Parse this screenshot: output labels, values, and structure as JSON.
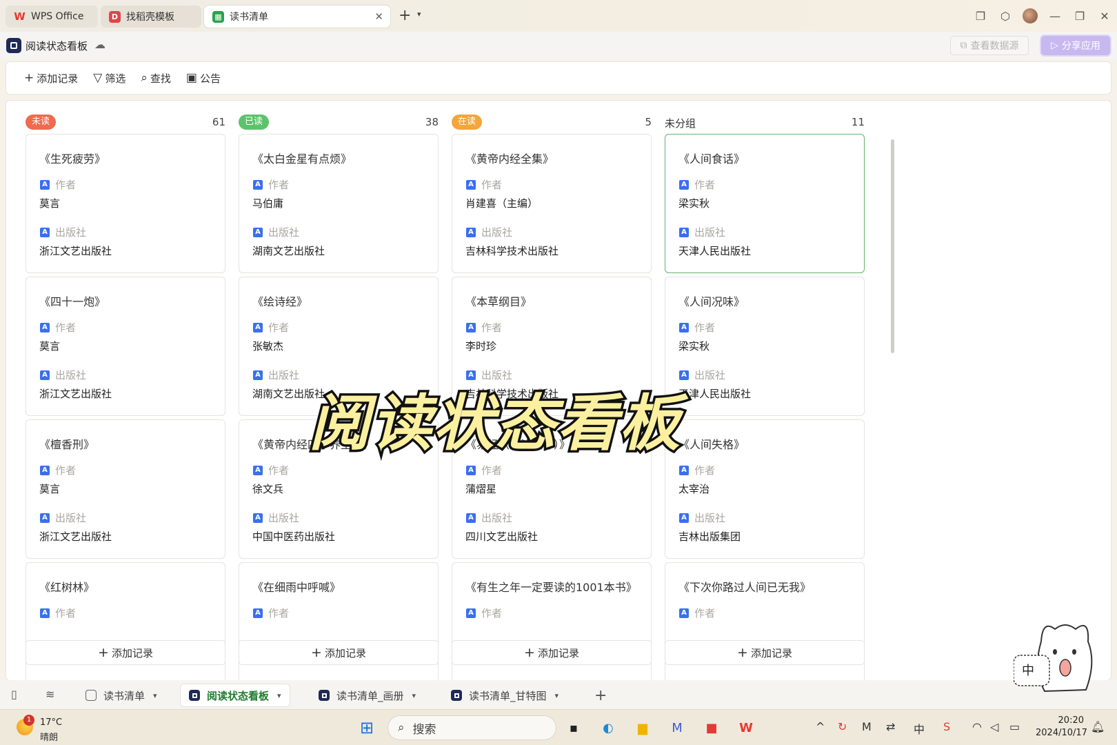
{
  "titlebar": {
    "tabs": [
      {
        "label": "WPS Office",
        "icon": "wps-logo-icon"
      },
      {
        "label": "找稻壳模板",
        "icon": "daoke-icon"
      },
      {
        "label": "读书清单",
        "icon": "sheet-icon"
      }
    ],
    "new_tab": "+"
  },
  "app": {
    "title": "阅读状态看板",
    "view_data_source": "查看数据源",
    "share_app": "分享应用"
  },
  "toolbar": {
    "add_record": "添加记录",
    "filter": "筛选",
    "find": "查找",
    "notice": "公告"
  },
  "labels": {
    "author": "作者",
    "publisher": "出版社",
    "add_record": "添加记录"
  },
  "columns": [
    {
      "name": "未读",
      "count": "61",
      "badge_color": "#ef6a4e",
      "badge": true,
      "cards": [
        {
          "title": "《生死疲劳》",
          "author": "莫言",
          "publisher": "浙江文艺出版社"
        },
        {
          "title": "《四十一炮》",
          "author": "莫言",
          "publisher": "浙江文艺出版社"
        },
        {
          "title": "《檀香刑》",
          "author": "莫言",
          "publisher": "浙江文艺出版社"
        },
        {
          "title": "《红树林》",
          "author": "",
          "publisher": ""
        }
      ]
    },
    {
      "name": "已读",
      "count": "38",
      "badge_color": "#5cc36a",
      "badge": true,
      "cards": [
        {
          "title": "《太白金星有点烦》",
          "author": "马伯庸",
          "publisher": "湖南文艺出版社"
        },
        {
          "title": "《绘诗经》",
          "author": "张敏杰",
          "publisher": "湖南文艺出版社"
        },
        {
          "title": "《黄帝内经四季养生法》",
          "author": "徐文兵",
          "publisher": "中国中医药出版社"
        },
        {
          "title": "《在细雨中呼喊》",
          "author": "",
          "publisher": ""
        }
      ]
    },
    {
      "name": "在读",
      "count": "5",
      "badge_color": "#f4a53c",
      "badge": true,
      "cards": [
        {
          "title": "《黄帝内经全集》",
          "author": "肖建喜（主编）",
          "publisher": "吉林科学技术出版社"
        },
        {
          "title": "《本草纲目》",
          "author": "李时珍",
          "publisher": "吉林科学技术出版社"
        },
        {
          "title": "《易经（全注全译）》",
          "author": "蒲熠星",
          "publisher": "四川文艺出版社"
        },
        {
          "title": "《有生之年一定要读的1001本书》",
          "author": "",
          "publisher": ""
        }
      ]
    },
    {
      "name": "未分组",
      "count": "11",
      "badge_color": "",
      "badge": false,
      "cards": [
        {
          "title": "《人间食话》",
          "author": "梁实秋",
          "publisher": "天津人民出版社"
        },
        {
          "title": "《人间况味》",
          "author": "梁实秋",
          "publisher": "天津人民出版社"
        },
        {
          "title": "《人间失格》",
          "author": "太宰治",
          "publisher": "吉林出版集团"
        },
        {
          "title": "《下次你路过人间已无我》",
          "author": "",
          "publisher": ""
        }
      ]
    }
  ],
  "overlay_caption": "阅读状态看板",
  "sheets": [
    {
      "label": "读书清单",
      "icon": "grid-table-icon",
      "active": false
    },
    {
      "label": "阅读状态看板",
      "icon": "kanban-icon",
      "active": true
    },
    {
      "label": "读书清单_画册",
      "icon": "gallery-icon",
      "active": false
    },
    {
      "label": "读书清单_甘特图",
      "icon": "gantt-icon",
      "active": false
    }
  ],
  "mascot_text": "中",
  "taskbar": {
    "weather_badge": "1",
    "temperature": "17°C",
    "condition": "晴朗",
    "search_placeholder": "搜索",
    "ime": "中",
    "time": "20:20",
    "date": "2024/10/17"
  },
  "colors": {
    "accent_green": "#1f7b2e",
    "share_purple": "#c8b8f0",
    "field_icon_blue": "#3a6ff1"
  }
}
